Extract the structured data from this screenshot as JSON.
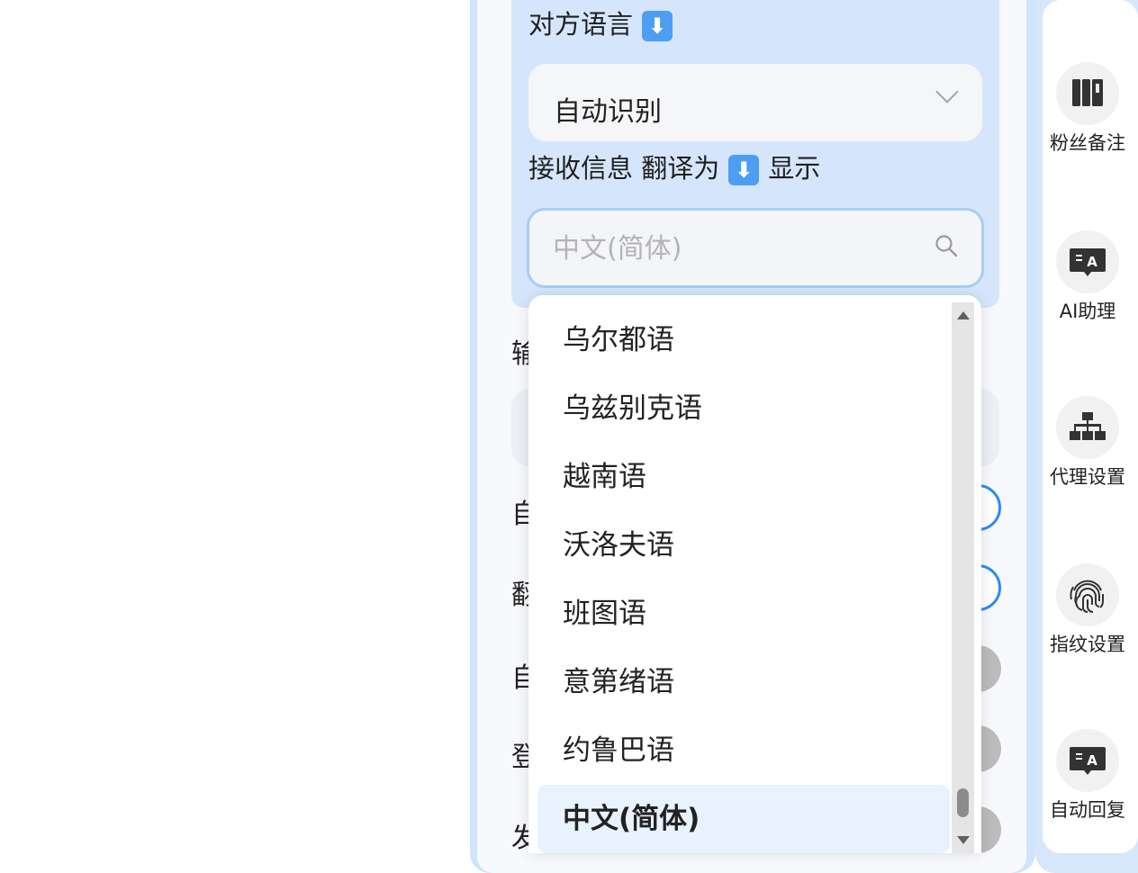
{
  "settings": {
    "peer_language_label": "对方语言",
    "peer_language_value": "自动识别",
    "receive_label": "接收信息 翻译为",
    "receive_suffix": "显示",
    "search_placeholder": "中文(简体)",
    "arrow_glyph": "⬇",
    "partial_rows": [
      "输",
      "自",
      "翻",
      "自",
      "登",
      "发"
    ]
  },
  "dropdown": {
    "options": [
      "乌尔都语",
      "乌兹别克语",
      "越南语",
      "沃洛夫语",
      "班图语",
      "意第绪语",
      "约鲁巴语",
      "中文(简体)"
    ],
    "selected": "中文(简体)"
  },
  "toolbar": {
    "items": [
      {
        "label": "粉丝备注",
        "icon": "book-icon"
      },
      {
        "label": "AI助理",
        "icon": "translate-chat-icon"
      },
      {
        "label": "代理设置",
        "icon": "network-tree-icon"
      },
      {
        "label": "指纹设置",
        "icon": "fingerprint-icon"
      },
      {
        "label": "自动回复",
        "icon": "translate-chat-icon"
      }
    ]
  },
  "colors": {
    "accent": "#2f8af5",
    "panel_blue": "#d5e6fc",
    "selected_bg": "#e8f3ff"
  }
}
